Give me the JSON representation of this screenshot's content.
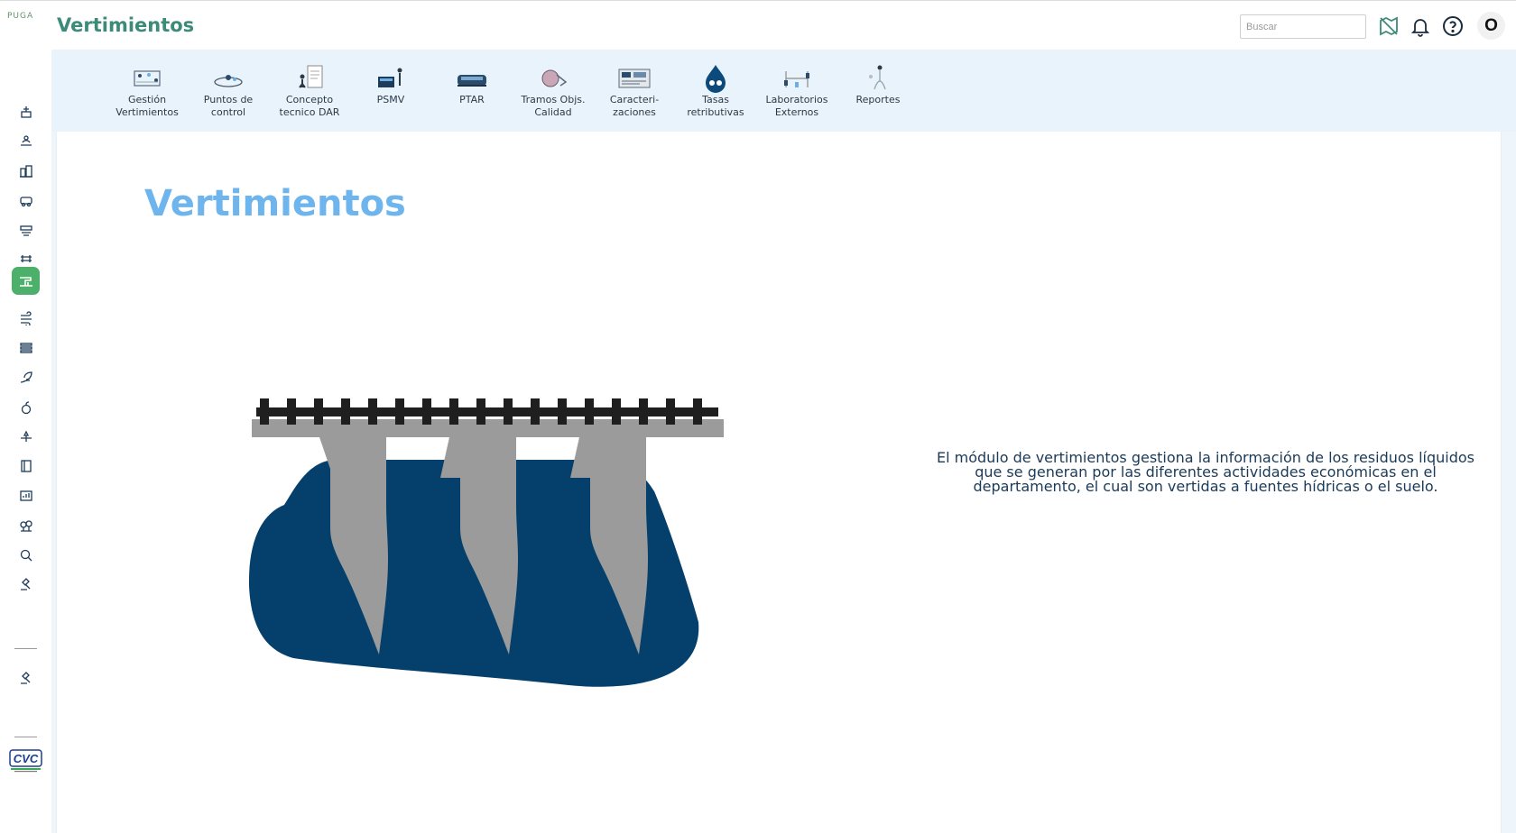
{
  "app": {
    "logo_text": "PUGA",
    "title": "Vertimientos"
  },
  "search": {
    "placeholder": "Buscar",
    "value": ""
  },
  "header_icons": [
    "map-off-icon",
    "bell-icon",
    "help-icon"
  ],
  "user": {
    "initial": "O"
  },
  "sidebar": {
    "items": [
      {
        "icon": "mining-icon",
        "active": false
      },
      {
        "icon": "landscape-icon",
        "active": false
      },
      {
        "icon": "buildings-icon",
        "active": false
      },
      {
        "icon": "vehicle-icon",
        "active": false
      },
      {
        "icon": "water-flow-icon",
        "active": false
      },
      {
        "icon": "river-icon",
        "active": false
      },
      {
        "icon": "discharge-pipe-icon",
        "active": true
      },
      {
        "icon": "wind-icon",
        "active": false
      },
      {
        "icon": "layers-icon",
        "active": false
      },
      {
        "icon": "leaf-hand-icon",
        "active": false
      },
      {
        "icon": "fruit-icon",
        "active": false
      },
      {
        "icon": "flower-icon",
        "active": false
      },
      {
        "icon": "book-icon",
        "active": false
      },
      {
        "icon": "report-chart-icon",
        "active": false
      },
      {
        "icon": "trees-icon",
        "active": false
      },
      {
        "icon": "search-document-icon",
        "active": false
      },
      {
        "icon": "gavel-icon",
        "active": false
      }
    ],
    "bottom_icon": "gavel-icon",
    "org_logo_text": "CVC"
  },
  "modules": [
    {
      "label": "Gestión\nVertimientos",
      "icon": "management-icon"
    },
    {
      "label": "Puntos de\ncontrol",
      "icon": "location-points-icon"
    },
    {
      "label": "Concepto\ntecnico DAR",
      "icon": "technical-concept-icon"
    },
    {
      "label": "PSMV",
      "icon": "psmv-icon"
    },
    {
      "label": "PTAR",
      "icon": "ptar-icon"
    },
    {
      "label": "Tramos Objs.\nCalidad",
      "icon": "quality-icon"
    },
    {
      "label": "Caracteri-\nzaciones",
      "icon": "characterization-icon"
    },
    {
      "label": "Tasas\nretributivas",
      "icon": "water-drop-icon"
    },
    {
      "label": "Laboratorios\nExternos",
      "icon": "laboratory-icon"
    },
    {
      "label": "Reportes",
      "icon": "reports-icon"
    }
  ],
  "main": {
    "heading": "Vertimientos",
    "description": "El módulo de vertimientos gestiona la información de los residuos líquidos que se generan por las diferentes actividades económicas en el departamento, el cual son vertidas a fuentes hídricas o el suelo."
  },
  "colors": {
    "brand_title": "#3c8a78",
    "active_nav": "#4caf6a",
    "heading": "#6eb5ee",
    "water": "#053f6b",
    "pipe": "#9b9b9b",
    "module_bar": "#e9f3fb"
  }
}
